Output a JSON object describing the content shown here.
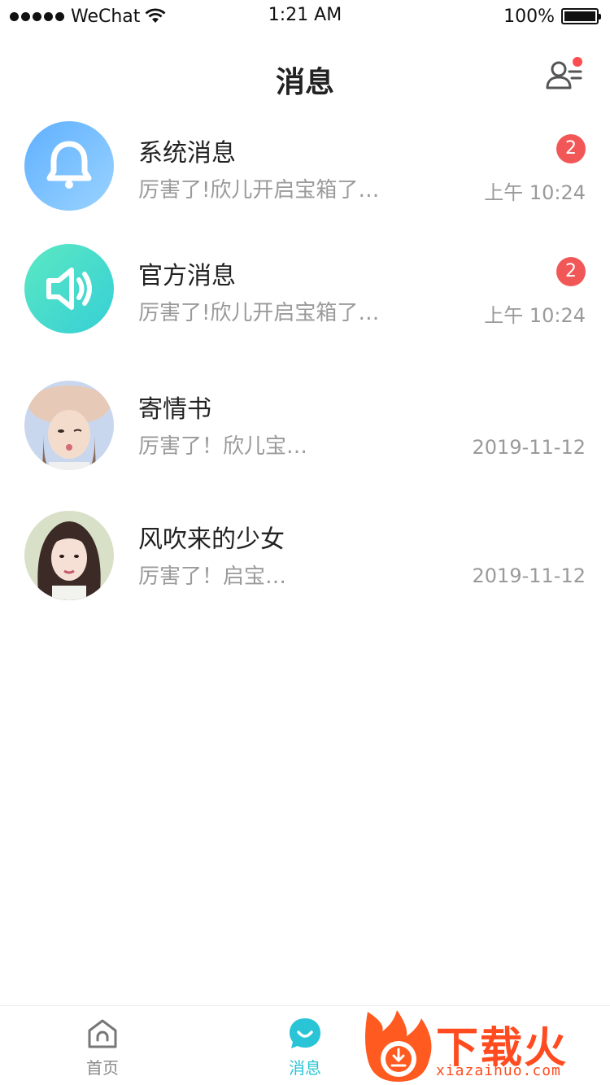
{
  "status_bar": {
    "carrier": "WeChat",
    "time": "1:21 AM",
    "battery": "100%",
    "battery_level": 1.0
  },
  "nav": {
    "title": "消息",
    "contacts_icon": "contacts-icon",
    "has_notification_dot": true
  },
  "messages": [
    {
      "name": "系统消息",
      "preview": "厉害了!欣儿开启宝箱了…",
      "time": "上午 10:24",
      "badge": "2",
      "avatar": "bell-icon",
      "avatar_colors": [
        "#6bb8ff",
        "#8ecbff"
      ]
    },
    {
      "name": "官方消息",
      "preview": "厉害了!欣儿开启宝箱了…",
      "time": "上午 10:24",
      "badge": "2",
      "avatar": "speaker-icon",
      "avatar_colors": [
        "#4fe0c2",
        "#3ad3d8"
      ]
    },
    {
      "name": "寄情书",
      "preview": "厉害了！欣儿宝…",
      "time": "2019-11-12",
      "badge": "",
      "avatar": "user-photo"
    },
    {
      "name": "风吹来的少女",
      "preview": "厉害了！启宝…",
      "time": "2019-11-12",
      "badge": "",
      "avatar": "user-photo"
    }
  ],
  "tabbar": {
    "home_label": "首页",
    "messages_label": "消息",
    "active_color": "#29c4d6",
    "inactive_color": "#888888"
  },
  "watermark": {
    "text": "下载火",
    "url": "xiazaihuo.com"
  }
}
